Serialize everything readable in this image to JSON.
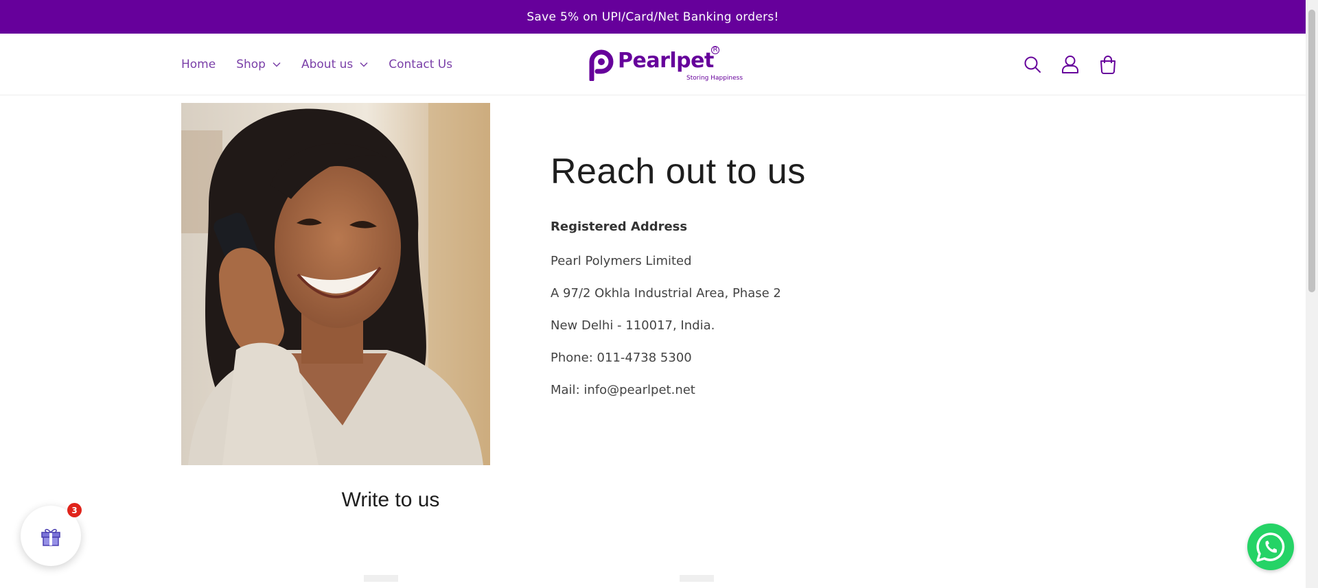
{
  "announcement": {
    "text": "Save 5% on UPI/Card/Net Banking orders!"
  },
  "nav": {
    "items": [
      {
        "label": "Home",
        "has_dropdown": false
      },
      {
        "label": "Shop",
        "has_dropdown": true
      },
      {
        "label": "About us",
        "has_dropdown": true
      },
      {
        "label": "Contact Us",
        "has_dropdown": false
      }
    ]
  },
  "logo": {
    "name": "Pearlpet",
    "tagline": "Storing Happiness",
    "registered_mark": "R"
  },
  "header_icons": [
    "search-icon",
    "account-icon",
    "cart-icon"
  ],
  "contact": {
    "heading": "Reach out to us",
    "address_title": "Registered Address",
    "lines": [
      "Pearl Polymers Limited",
      "A 97/2 Okhla Industrial Area, Phase 2",
      "New Delhi - 110017, India.",
      "Phone: 011-4738 5300",
      "Mail: info@pearlpet.net"
    ]
  },
  "form": {
    "title": "Write to us"
  },
  "widgets": {
    "gift_badge_count": "3"
  },
  "colors": {
    "brand_purple": "#66009b",
    "nav_text": "#7a3fa8",
    "whatsapp_green": "#25d366",
    "badge_red": "#e0241b"
  }
}
